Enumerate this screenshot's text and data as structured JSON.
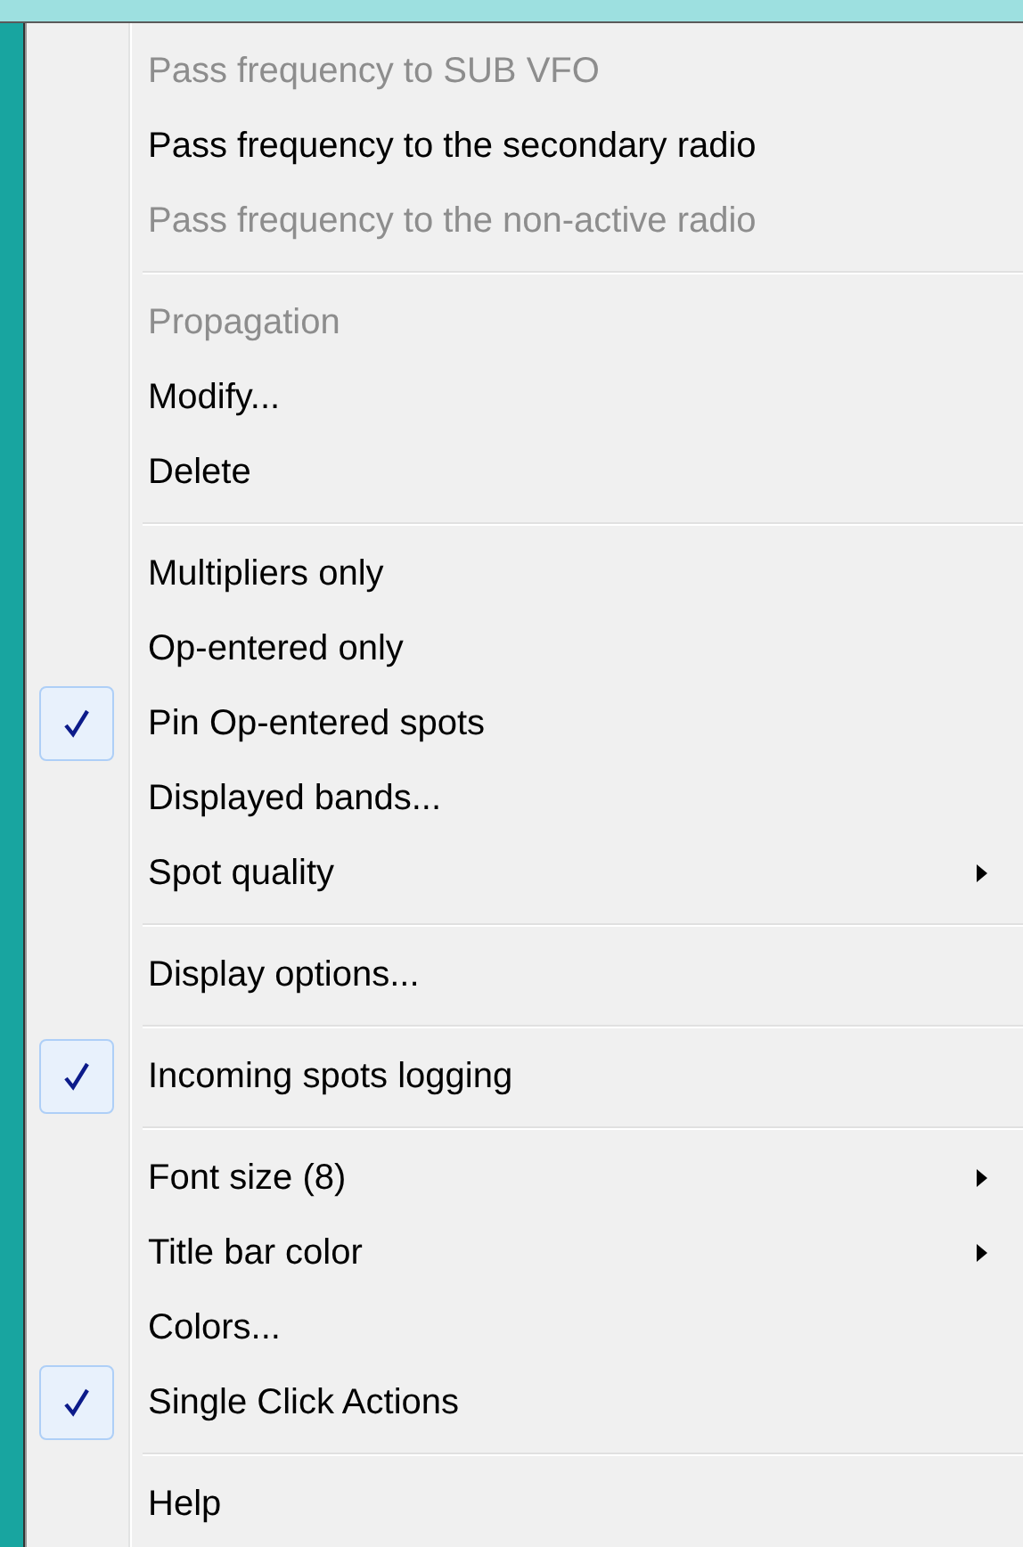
{
  "menu": {
    "items": [
      {
        "kind": "item",
        "label": "Pass frequency to SUB VFO",
        "disabled": true,
        "checked": false,
        "submenu": false
      },
      {
        "kind": "item",
        "label": "Pass frequency to the secondary radio",
        "disabled": false,
        "checked": false,
        "submenu": false
      },
      {
        "kind": "item",
        "label": "Pass frequency to the non-active radio",
        "disabled": true,
        "checked": false,
        "submenu": false
      },
      {
        "kind": "separator"
      },
      {
        "kind": "item",
        "label": "Propagation",
        "disabled": true,
        "checked": false,
        "submenu": false
      },
      {
        "kind": "item",
        "label": "Modify...",
        "disabled": false,
        "checked": false,
        "submenu": false
      },
      {
        "kind": "item",
        "label": "Delete",
        "disabled": false,
        "checked": false,
        "submenu": false
      },
      {
        "kind": "separator"
      },
      {
        "kind": "item",
        "label": "Multipliers only",
        "disabled": false,
        "checked": false,
        "submenu": false
      },
      {
        "kind": "item",
        "label": "Op-entered only",
        "disabled": false,
        "checked": false,
        "submenu": false
      },
      {
        "kind": "item",
        "label": "Pin Op-entered spots",
        "disabled": false,
        "checked": true,
        "submenu": false
      },
      {
        "kind": "item",
        "label": "Displayed bands...",
        "disabled": false,
        "checked": false,
        "submenu": false
      },
      {
        "kind": "item",
        "label": "Spot quality",
        "disabled": false,
        "checked": false,
        "submenu": true
      },
      {
        "kind": "separator"
      },
      {
        "kind": "item",
        "label": "Display options...",
        "disabled": false,
        "checked": false,
        "submenu": false
      },
      {
        "kind": "separator"
      },
      {
        "kind": "item",
        "label": "Incoming spots logging",
        "disabled": false,
        "checked": true,
        "submenu": false
      },
      {
        "kind": "separator"
      },
      {
        "kind": "item",
        "label": "Font size (8)",
        "disabled": false,
        "checked": false,
        "submenu": true
      },
      {
        "kind": "item",
        "label": "Title bar color",
        "disabled": false,
        "checked": false,
        "submenu": true
      },
      {
        "kind": "item",
        "label": "Colors...",
        "disabled": false,
        "checked": false,
        "submenu": false
      },
      {
        "kind": "item",
        "label": "Single Click Actions",
        "disabled": false,
        "checked": true,
        "submenu": false
      },
      {
        "kind": "separator"
      },
      {
        "kind": "item",
        "label": "Help",
        "disabled": false,
        "checked": false,
        "submenu": false
      }
    ]
  }
}
